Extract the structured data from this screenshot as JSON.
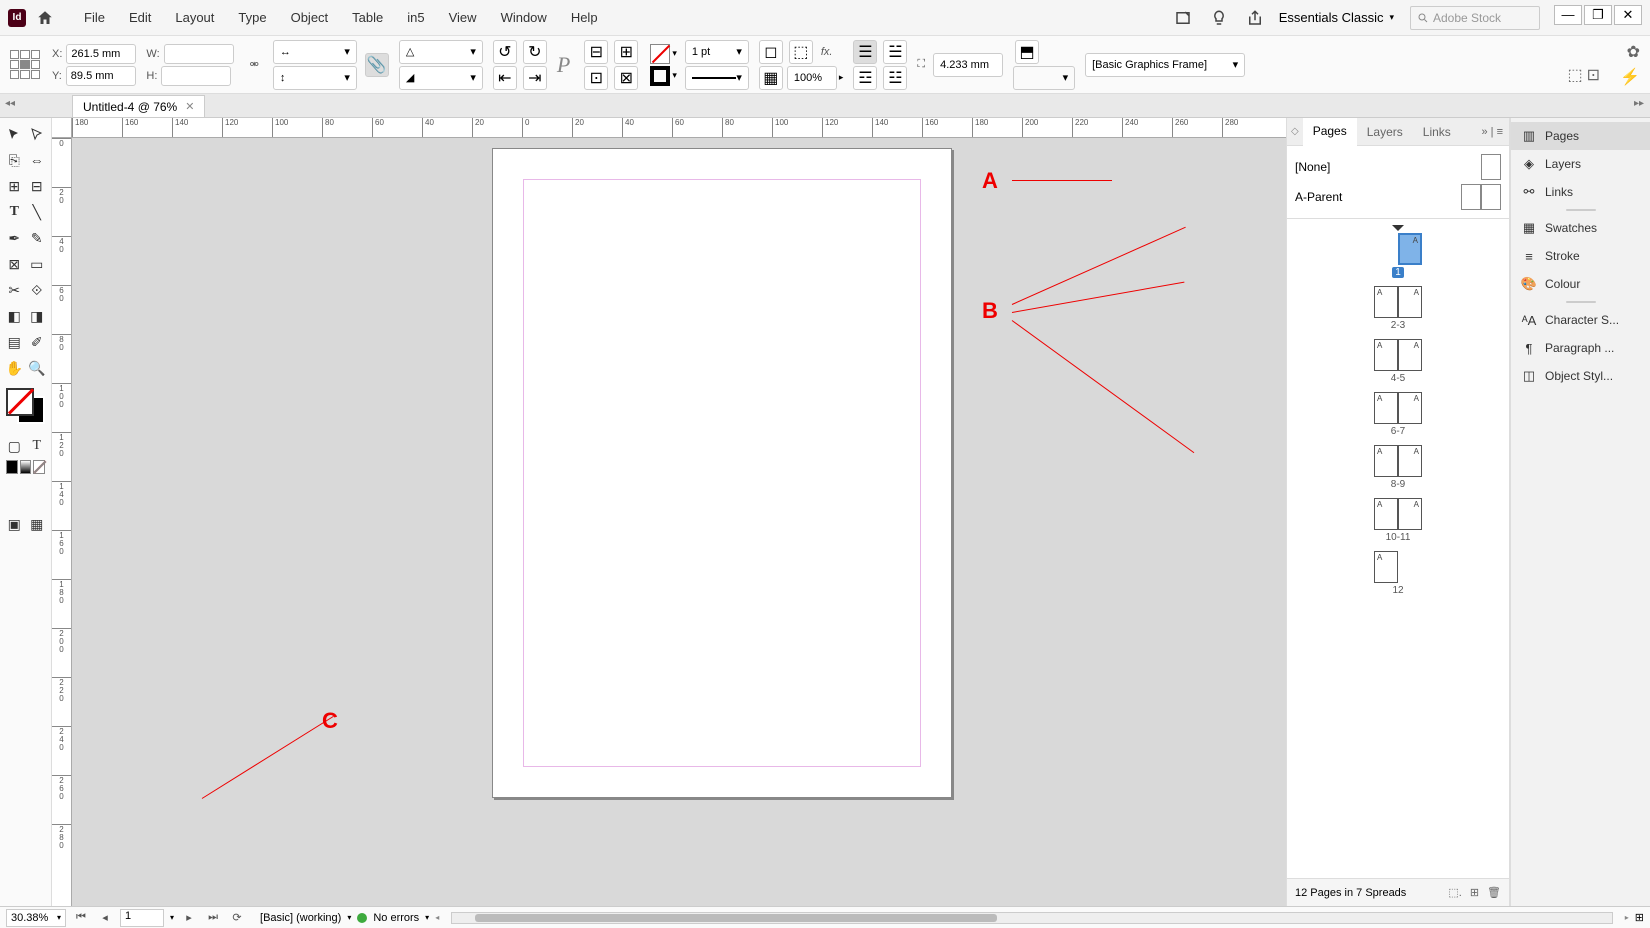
{
  "menu": {
    "items": [
      "File",
      "Edit",
      "Layout",
      "Type",
      "Object",
      "Table",
      "in5",
      "View",
      "Window",
      "Help"
    ],
    "workspace": "Essentials Classic",
    "search_placeholder": "Adobe Stock"
  },
  "control": {
    "x_label": "X:",
    "x_val": "261.5 mm",
    "y_label": "Y:",
    "y_val": "89.5 mm",
    "w_label": "W:",
    "h_label": "H:",
    "stroke_weight": "1 pt",
    "gap_val": "4.233 mm",
    "zoom_pct": "100%",
    "style_select": "[Basic Graphics Frame]"
  },
  "tab": {
    "title": "Untitled-4 @ 76%"
  },
  "ruler_h": [
    "180",
    "160",
    "140",
    "120",
    "100",
    "80",
    "60",
    "40",
    "20",
    "0",
    "20",
    "40",
    "60",
    "80",
    "100",
    "120",
    "140",
    "160",
    "180",
    "200",
    "220",
    "240",
    "260",
    "280"
  ],
  "ruler_v": [
    "0",
    "20",
    "40",
    "60",
    "80",
    "100",
    "120",
    "140",
    "160",
    "180",
    "200",
    "220",
    "240",
    "260",
    "280"
  ],
  "pages_panel": {
    "tabs": [
      "Pages",
      "Layers",
      "Links"
    ],
    "none": "[None]",
    "parent": "A-Parent",
    "spreads": [
      {
        "pages": [
          "A"
        ],
        "num": "1",
        "single": true,
        "selected": true
      },
      {
        "pages": [
          "A",
          "A"
        ],
        "num": "2-3"
      },
      {
        "pages": [
          "A",
          "A"
        ],
        "num": "4-5"
      },
      {
        "pages": [
          "A",
          "A"
        ],
        "num": "6-7"
      },
      {
        "pages": [
          "A",
          "A"
        ],
        "num": "8-9"
      },
      {
        "pages": [
          "A",
          "A"
        ],
        "num": "10-11"
      },
      {
        "pages": [
          "A"
        ],
        "num": "12",
        "singleLeft": true
      }
    ],
    "footer": "12 Pages in 7 Spreads"
  },
  "dock": [
    "Pages",
    "Layers",
    "Links",
    "Swatches",
    "Stroke",
    "Colour",
    "Character S...",
    "Paragraph ...",
    "Object Styl..."
  ],
  "status": {
    "zoom": "30.38%",
    "page": "1",
    "preflight": "[Basic] (working)",
    "errors": "No errors"
  },
  "annotations": {
    "a": "A",
    "b": "B",
    "c": "C"
  }
}
